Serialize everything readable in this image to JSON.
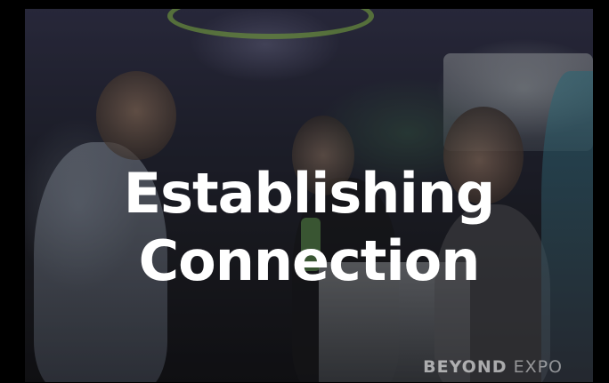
{
  "headline": {
    "line1": "Establishing",
    "line2": "Connection"
  },
  "watermark": {
    "brand_bold": "BEYOND",
    "brand_light": "EXPO"
  }
}
